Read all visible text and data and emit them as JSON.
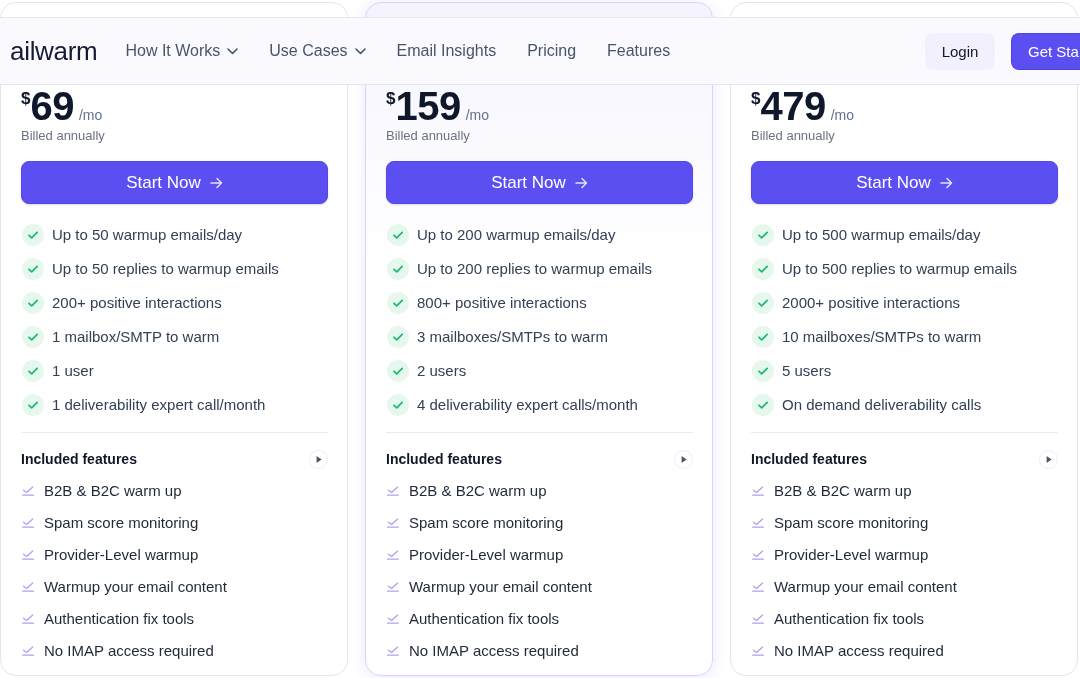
{
  "header": {
    "logo": "ailwarm",
    "nav": [
      {
        "label": "How It Works",
        "kind": "dropdown"
      },
      {
        "label": "Use Cases",
        "kind": "dropdown"
      },
      {
        "label": "Email Insights",
        "kind": "link"
      },
      {
        "label": "Pricing",
        "kind": "link"
      },
      {
        "label": "Features",
        "kind": "link"
      }
    ],
    "login": "Login",
    "cta": "Get Sta"
  },
  "plans": [
    {
      "featured": false,
      "currency": "$",
      "price": "69",
      "period": "/mo",
      "billing": "Billed annually",
      "button": "Start Now",
      "limits": [
        "Up to 50 warmup emails/day",
        "Up to 50 replies to warmup emails",
        "200+ positive interactions",
        "1 mailbox/SMTP to warm",
        "1 user",
        "1 deliverability expert call/month"
      ],
      "included_title": "Included features",
      "included": [
        "B2B & B2C warm up",
        "Spam score monitoring",
        "Provider-Level warmup",
        "Warmup your email content",
        "Authentication fix tools",
        "No IMAP access required"
      ]
    },
    {
      "featured": true,
      "currency": "$",
      "price": "159",
      "period": "/mo",
      "billing": "Billed annually",
      "button": "Start Now",
      "limits": [
        "Up to 200 warmup emails/day",
        "Up to 200 replies to warmup emails",
        "800+ positive interactions",
        "3 mailboxes/SMTPs to warm",
        "2 users",
        "4 deliverability expert calls/month"
      ],
      "included_title": "Included features",
      "included": [
        "B2B & B2C warm up",
        "Spam score monitoring",
        "Provider-Level warmup",
        "Warmup your email content",
        "Authentication fix tools",
        "No IMAP access required"
      ]
    },
    {
      "featured": false,
      "currency": "$",
      "price": "479",
      "period": "/mo",
      "billing": "Billed annually",
      "button": "Start Now",
      "limits": [
        "Up to 500 warmup emails/day",
        "Up to 500 replies to warmup emails",
        "2000+ positive interactions",
        "10 mailboxes/SMTPs to warm",
        "5 users",
        "On demand deliverability calls"
      ],
      "included_title": "Included features",
      "included": [
        "B2B & B2C warm up",
        "Spam score monitoring",
        "Provider-Level warmup",
        "Warmup your email content",
        "Authentication fix tools",
        "No IMAP access required"
      ]
    }
  ]
}
